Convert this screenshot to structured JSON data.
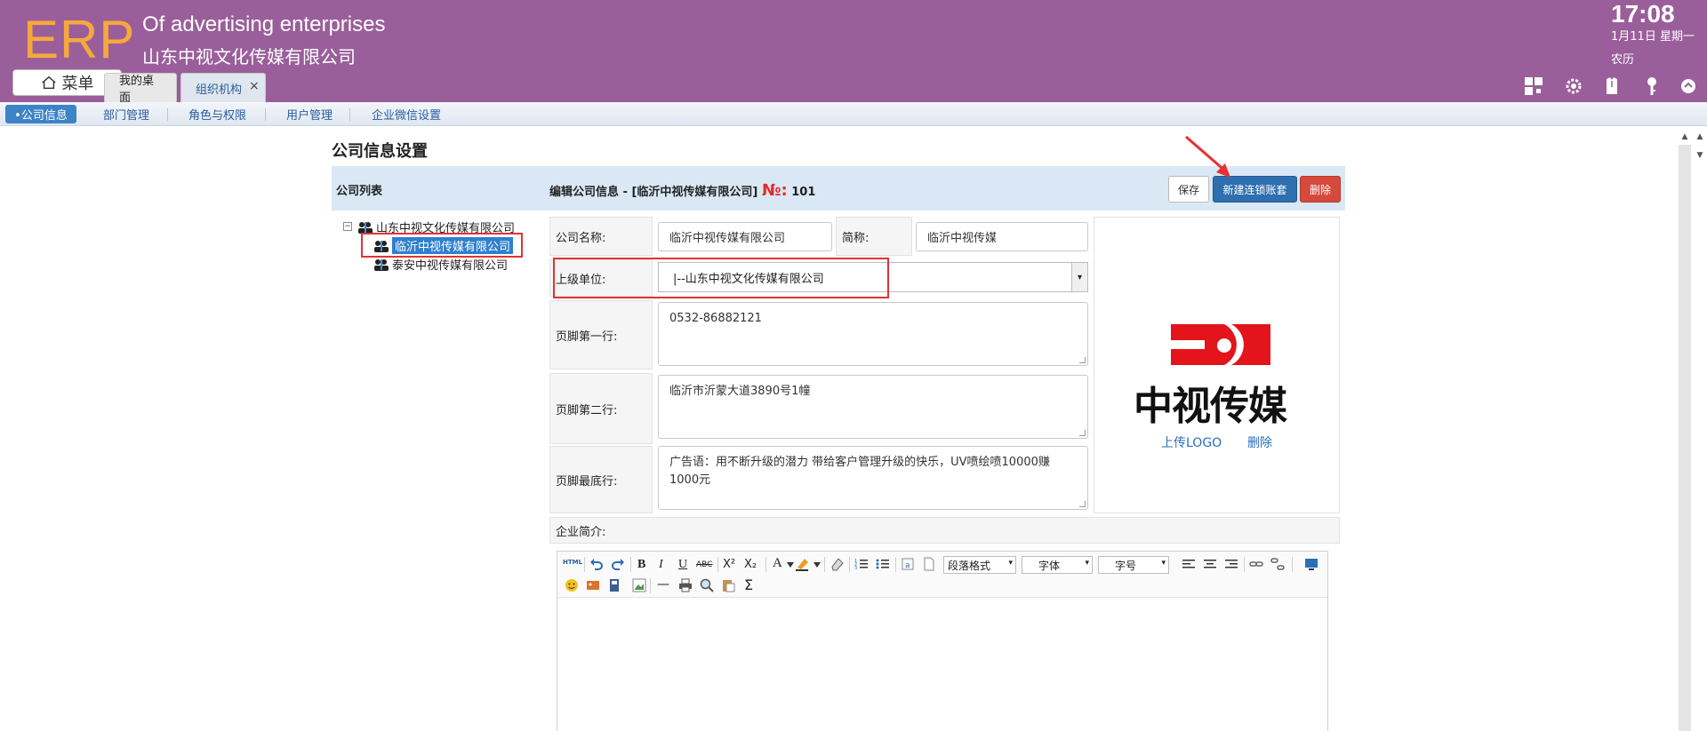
{
  "header": {
    "logo_text": "ERP",
    "title": "Of advertising enterprises",
    "company": "山东中视文化传媒有限公司",
    "menu_label": "菜单",
    "time": "17:08",
    "date": "1月11日 星期一",
    "lunar": "农历",
    "icons": [
      "grid-icon",
      "gear-icon",
      "shirt-icon",
      "key-icon",
      "collapse-up-icon"
    ]
  },
  "tabs": [
    {
      "label": "我的桌面"
    },
    {
      "label": "组织机构",
      "close": "×"
    }
  ],
  "subnav": [
    {
      "label": "•公司信息",
      "active": true
    },
    {
      "label": "部门管理"
    },
    {
      "label": "角色与权限"
    },
    {
      "label": "用户管理"
    },
    {
      "label": "企业微信设置"
    }
  ],
  "page": {
    "title": "公司信息设置",
    "list_title": "公司列表",
    "edit_title_prefix": "编辑公司信息 - [临沂中视传媒有限公司]",
    "edit_no_label": "№:",
    "edit_no_value": "101",
    "buttons": {
      "save": "保存",
      "new_chain": "新建连锁账套",
      "delete": "删除"
    }
  },
  "tree": {
    "toggle": "−",
    "root": "山东中视文化传媒有限公司",
    "children": [
      "临沂中视传媒有限公司",
      "泰安中视传媒有限公司"
    ]
  },
  "form": {
    "company_name_label": "公司名称:",
    "company_name_value": "临沂中视传媒有限公司",
    "short_name_label": "简称:",
    "short_name_value": "临沂中视传媒",
    "parent_label": "上级单位:",
    "parent_value": "|--山东中视文化传媒有限公司",
    "footer1_label": "页脚第一行:",
    "footer1_value": "0532-86882121",
    "footer2_label": "页脚第二行:",
    "footer2_value": "临沂市沂蒙大道3890号1幢",
    "footer3_label": "页脚最底行:",
    "footer3_value": "广告语：用不断升级的潜力 带给客户管理升级的快乐，UV喷绘喷10000赚1000元",
    "intro_label": "企业简介:"
  },
  "logo": {
    "brand_text": "中视传媒",
    "upload_label": "上传LOGO",
    "delete_label": "删除",
    "brand_color": "#e3141b"
  },
  "editor": {
    "html_label": "HTML",
    "paragraph_label": "段落格式",
    "font_label": "字体",
    "size_label": "字号",
    "bold": "B",
    "italic": "I",
    "underline": "U",
    "strike": "ABC",
    "sup": "X²",
    "sub": "X₂",
    "fontcolor": "A",
    "sigma": "Σ",
    "hr": "—"
  },
  "colors": {
    "header_bg": "#9a5f9a",
    "logo_orange": "#f6a83c",
    "primary_blue": "#2f6fb0",
    "danger_red": "#d64a3e"
  }
}
